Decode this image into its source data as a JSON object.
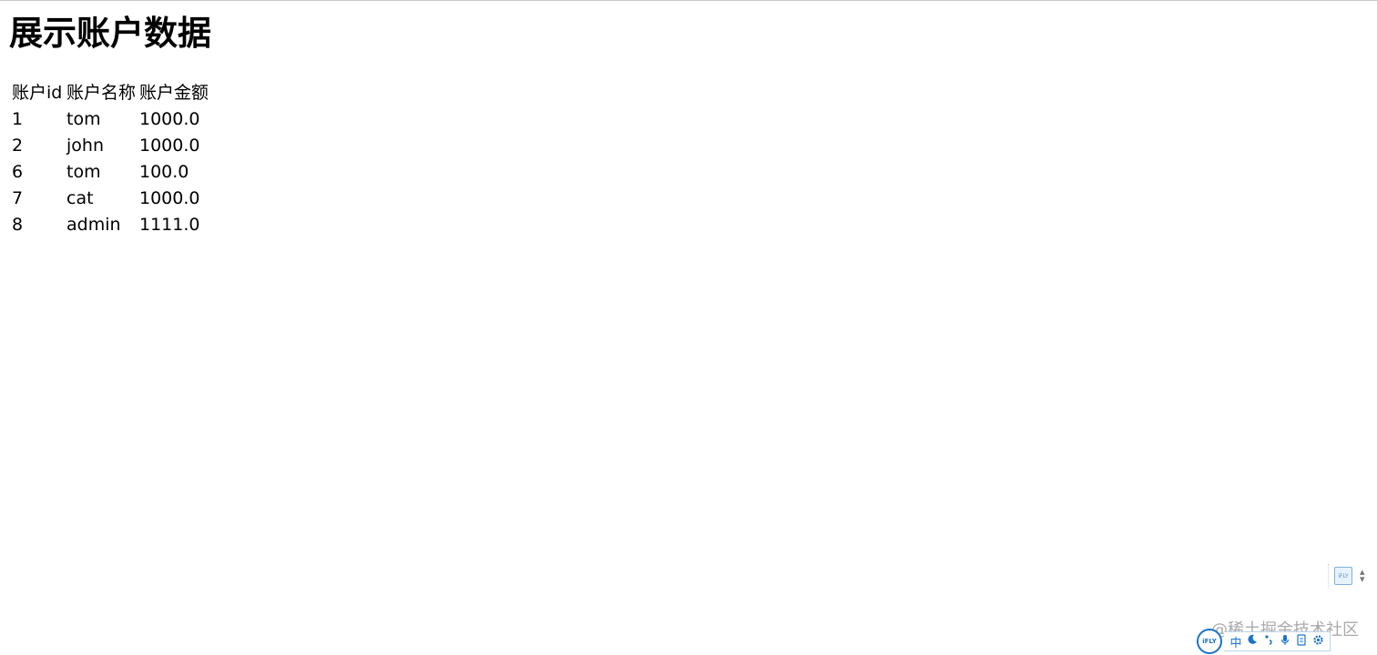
{
  "page": {
    "title": "展示账户数据"
  },
  "table": {
    "headers": [
      "账户id",
      "账户名称",
      "账户金额"
    ],
    "rows": [
      [
        "1",
        "tom",
        "1000.0"
      ],
      [
        "2",
        "john",
        "1000.0"
      ],
      [
        "6",
        "tom",
        "100.0"
      ],
      [
        "7",
        "cat",
        "1000.0"
      ],
      [
        "8",
        "admin",
        "1111.0"
      ]
    ]
  },
  "ime": {
    "logo_text": "iFLY",
    "mode_label": "中",
    "icons": [
      "moon-icon",
      "punctuation-icon",
      "microphone-icon",
      "keyboard-icon",
      "settings-icon"
    ]
  },
  "watermark": {
    "text": "@稀土掘金技术社区"
  },
  "colors": {
    "ime_accent": "#1a73c9",
    "watermark": "#8c8c8c"
  }
}
